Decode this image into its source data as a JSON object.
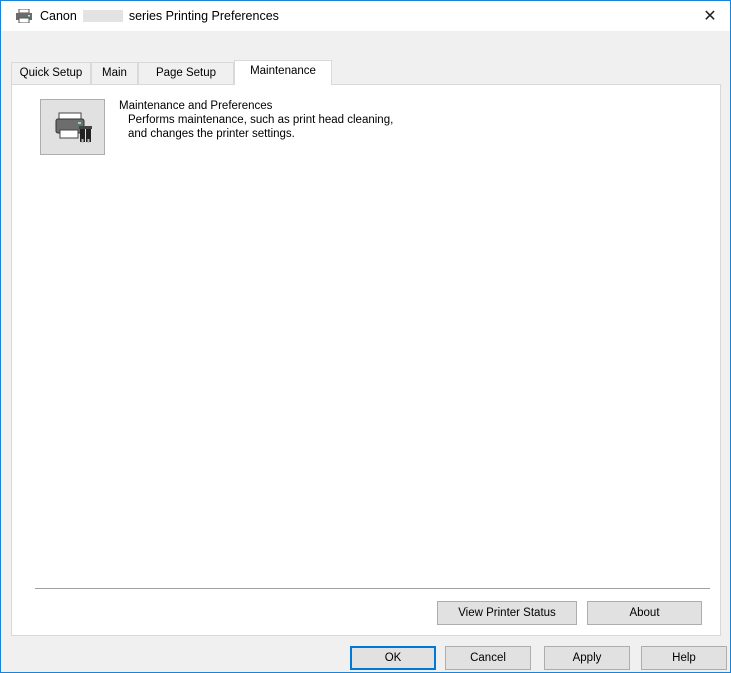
{
  "window": {
    "title_prefix": "Canon",
    "title_suffix": "series Printing Preferences",
    "close_glyph": "✕"
  },
  "tabs": [
    {
      "label": "Quick Setup"
    },
    {
      "label": "Main"
    },
    {
      "label": "Page Setup"
    },
    {
      "label": "Maintenance",
      "active": true
    }
  ],
  "maintenance": {
    "title": "Maintenance and Preferences",
    "description": "Performs maintenance, such as print head cleaning, and changes the printer settings.",
    "icon": "printer-tools-icon"
  },
  "panel_buttons": {
    "view_status": "View Printer Status",
    "about": "About"
  },
  "dialog_buttons": {
    "ok": "OK",
    "cancel": "Cancel",
    "apply": "Apply",
    "help": "Help"
  },
  "colors": {
    "accent": "#0078d7",
    "window_border": "#1883d7",
    "face": "#f0f0f0"
  }
}
